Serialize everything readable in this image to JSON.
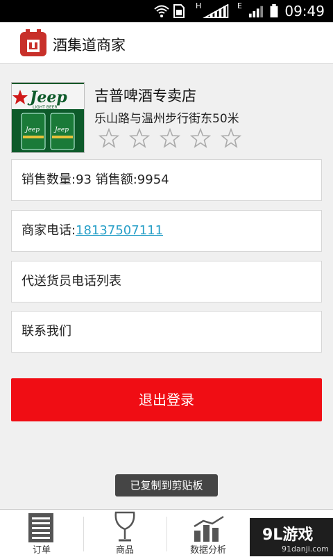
{
  "status_bar": {
    "time": "09:49",
    "network_h": "H",
    "network_e": "E"
  },
  "app": {
    "title": "酒集道商家"
  },
  "shop": {
    "name": "吉普啤酒专卖店",
    "address": "乐山路与温州步行街东50米",
    "image_text": "Jeep",
    "image_subtext": "LIGHT BEER",
    "rating": 0,
    "max_rating": 5
  },
  "info": {
    "sales_count_label": "销售数量:",
    "sales_count": "93",
    "sales_amount_label": "销售额:",
    "sales_amount": "9954",
    "phone_label": "商家电话:",
    "phone": "18137507111",
    "delivery_phones": "代送货员电话列表",
    "contact": "联系我们"
  },
  "logout_label": "退出登录",
  "toast": "已复制到剪贴板",
  "tabs": [
    {
      "label": "订单",
      "icon": "list-icon"
    },
    {
      "label": "商品",
      "icon": "wine-glass-icon"
    },
    {
      "label": "数据分析",
      "icon": "bar-chart-icon"
    }
  ],
  "watermark": {
    "brand": "9L游戏",
    "site": "91danji.com"
  },
  "colors": {
    "accent": "#f00d14",
    "link": "#2aa0c8",
    "logo": "#c8302a"
  }
}
